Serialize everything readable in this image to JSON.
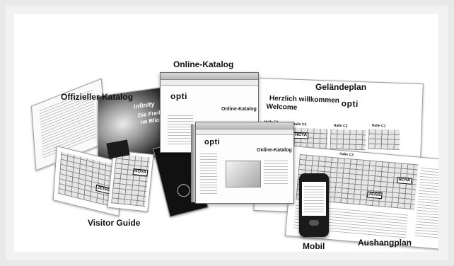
{
  "labels": {
    "online_katalog": "Online-Katalog",
    "offizieller_katalog": "Offizieller Katalog",
    "gelaendeplan": "Geländeplan",
    "visitor_guide": "Visitor Guide",
    "mobil": "Mobil",
    "aushangplan": "Aushangplan"
  },
  "browser": {
    "logo": "opti",
    "page_title": "Online-Katalog"
  },
  "plan": {
    "heading_de": "Herzlich willkommen",
    "heading_en": "Welcome",
    "logo": "opti",
    "halls": [
      "Halle C4",
      "Halle C3",
      "Halle C2",
      "Halle C1",
      "Halle C3"
    ],
    "brands": [
      "HOYA",
      "ZEISS",
      "HOYA"
    ]
  },
  "catalog": {
    "cover_text_1": "infinity",
    "cover_text_2": "Die Freiheit",
    "cover_text_3": "im Blick",
    "brands": [
      "ZEISS",
      "HOYA"
    ]
  }
}
